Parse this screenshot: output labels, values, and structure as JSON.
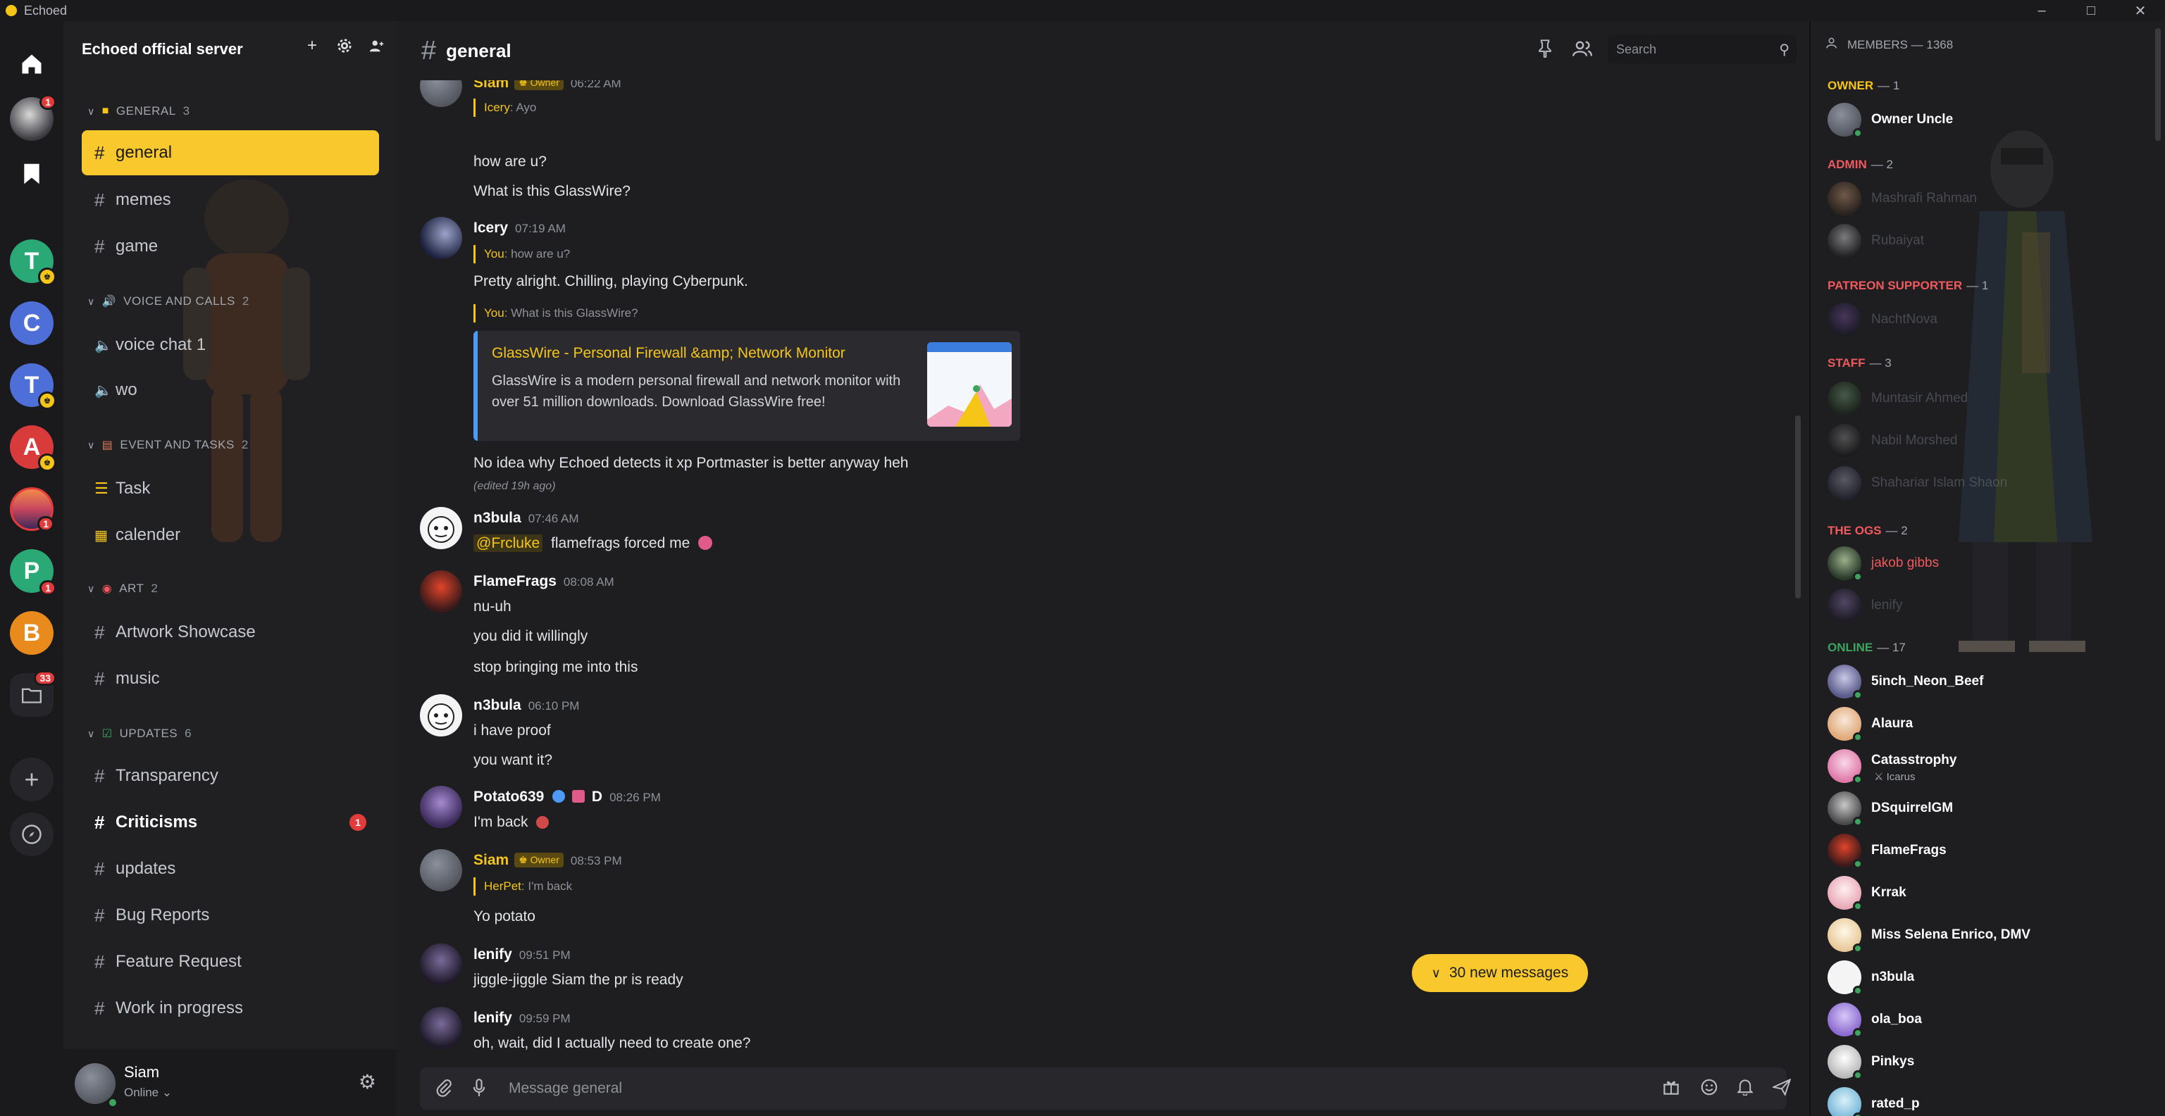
{
  "window": {
    "title": "Echoed"
  },
  "server": {
    "name": "Echoed official server"
  },
  "rail": {
    "items": [
      {
        "letter": "T",
        "color": "#2aa876"
      },
      {
        "letter": "C",
        "color": "#4f6fd8"
      },
      {
        "letter": "T",
        "color": "#4f6fd8"
      },
      {
        "letter": "A",
        "color": "#d93a3a"
      },
      {
        "letter": "P",
        "color": "#2aa876"
      },
      {
        "letter": "B",
        "color": "#e88a1c"
      }
    ],
    "badges": {
      "profile": "1",
      "sunset": "1",
      "p": "1",
      "folder": "33"
    }
  },
  "categories": {
    "general": {
      "name": "GENERAL",
      "count": "3"
    },
    "voice": {
      "name": "VOICE AND CALLS",
      "count": "2"
    },
    "events": {
      "name": "EVENT AND TASKS",
      "count": "2"
    },
    "art": {
      "name": "ART",
      "count": "2"
    },
    "updates": {
      "name": "UPDATES",
      "count": "6"
    }
  },
  "channels": {
    "general": "general",
    "memes": "memes",
    "game": "game",
    "voice1": "voice chat 1",
    "wo": "wo",
    "task": "Task",
    "calender": "calender",
    "artwork": "Artwork Showcase",
    "music": "music",
    "transparency": "Transparency",
    "criticisms": "Criticisms",
    "criticisms_badge": "1",
    "updates": "updates",
    "bugreports": "Bug Reports",
    "featurerequest": "Feature Request",
    "wip": "Work in progress"
  },
  "user": {
    "name": "Siam",
    "status": "Online"
  },
  "chat": {
    "channel": "general",
    "search_placeholder": "Search",
    "composer_placeholder": "Message general",
    "new_messages": "30 new messages"
  },
  "messages": {
    "m1": {
      "author": "Siam",
      "tag": "Owner",
      "time": "06:22 AM",
      "reply_name": "Icery",
      "reply_text": ": Ayo",
      "line1": "how are u?",
      "line2": "What is this GlassWire?"
    },
    "m2": {
      "author": "Icery",
      "time": "07:19 AM",
      "reply1_name": "You",
      "reply1_text": ": how are u?",
      "line1": "Pretty alright. Chilling, playing Cyberpunk.",
      "reply2_name": "You",
      "reply2_text": ": What is this GlassWire?",
      "embed_title": "GlassWire - Personal Firewall &amp; Network Monitor",
      "embed_desc": "GlassWire is a modern personal firewall and network monitor with over 51 million downloads. Download GlassWire free!",
      "line2": "No idea why Echoed detects it xp Portmaster is better anyway heh",
      "edited": "(edited 19h ago)"
    },
    "m3": {
      "author": "n3bula",
      "time": "07:46 AM",
      "mention": "@Frcluke",
      "text": "flamefrags forced me"
    },
    "m4": {
      "author": "FlameFrags",
      "time": "08:08 AM",
      "line1": "nu-uh",
      "line2": "you did it willingly",
      "line3": "stop bringing me into this"
    },
    "m5": {
      "author": "n3bula",
      "time": "06:10 PM",
      "line1": "i have proof",
      "line2": "you want it?"
    },
    "m6": {
      "author": "Potato639",
      "badge": "D",
      "time": "08:26 PM",
      "line1": "I'm back"
    },
    "m7": {
      "author": "Siam",
      "tag": "Owner",
      "time": "08:53 PM",
      "reply_name": "HerPet",
      "reply_text": ": I'm back",
      "line1": "Yo potato"
    },
    "m8": {
      "author": "lenify",
      "time": "09:51 PM",
      "line1": "jiggle-jiggle Siam the pr is ready"
    },
    "m9": {
      "author": "lenify",
      "time": "09:59 PM",
      "line1": "oh, wait, did I actually need to create one?"
    }
  },
  "members": {
    "header": "MEMBERS — 1368",
    "groups": {
      "owner": {
        "name": "OWNER",
        "count": "— 1",
        "color": "#f5c518"
      },
      "admin": {
        "name": "ADMIN",
        "count": "— 2",
        "color": "#f0595e"
      },
      "patreon": {
        "name": "PATREON SUPPORTER",
        "count": "— 1",
        "color": "#f0595e"
      },
      "staff": {
        "name": "STAFF",
        "count": "— 3",
        "color": "#f0595e"
      },
      "ogs": {
        "name": "THE OGS",
        "count": "— 2",
        "color": "#f0595e"
      },
      "online": {
        "name": "ONLINE",
        "count": "— 17",
        "color": "#3ba55d"
      }
    },
    "list": {
      "owner_uncle": "Owner Uncle",
      "mashrafi": "Mashrafi Rahman",
      "rubaiyat": "Rubaiyat",
      "nachtnova": "NachtNova",
      "muntasir": "Muntasir Ahmed",
      "nabil": "Nabil Morshed",
      "shahariar": "Shahariar Islam Shaon",
      "jakob": "jakob gibbs",
      "lenify": "lenify",
      "sinch": "5inch_Neon_Beef",
      "alaura": "Alaura",
      "catas": "Catasstrophy",
      "catas_sub": "Icarus",
      "dsquirrel": "DSquirrelGM",
      "flamefrags": "FlameFrags",
      "krrak": "Krrak",
      "selena": "Miss Selena Enrico, DMV",
      "n3bula": "n3bula",
      "ola": "ola_boa",
      "pinkys": "Pinkys",
      "rated": "rated_p"
    }
  }
}
